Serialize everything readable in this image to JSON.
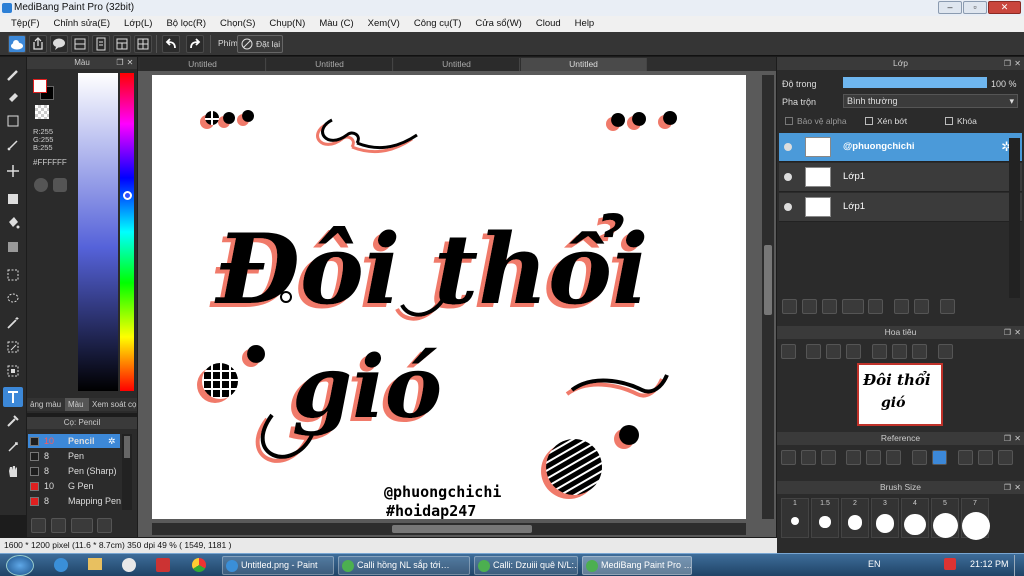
{
  "window": {
    "title": "MediBang Paint Pro (32bit)"
  },
  "menu": [
    "Tệp(F)",
    "Chỉnh sửa(E)",
    "Lớp(L)",
    "Bộ lọc(R)",
    "Chọn(S)",
    "Chụp(N)",
    "Màu (C)",
    "Xem(V)",
    "Công cụ(T)",
    "Cửa sổ(W)",
    "Cloud",
    "Help"
  ],
  "toolbar": {
    "phim_label": "Phím",
    "reset_label": "Đặt lại"
  },
  "color_panel": {
    "title": "Màu",
    "r": "R:255",
    "g": "G:255",
    "b": "B:255",
    "hex": "#FFFFFF",
    "tabs": [
      "ảng màu",
      "Màu",
      "Xem soát cọ"
    ]
  },
  "brush_panel": {
    "title": "Cọ: Pencil",
    "items": [
      {
        "size": "10",
        "name": "Pencil",
        "color": "#1e1e1e"
      },
      {
        "size": "8",
        "name": "Pen",
        "color": "#1e1e1e"
      },
      {
        "size": "8",
        "name": "Pen (Sharp)",
        "color": "#1e1e1e"
      },
      {
        "size": "10",
        "name": "G Pen",
        "color": "#e02020"
      },
      {
        "size": "8",
        "name": "Mapping Pen",
        "color": "#e02020"
      }
    ]
  },
  "tabs": [
    "Untitled",
    "Untitled",
    "Untitled",
    "Untitled"
  ],
  "artwork": {
    "line1": "Đôi thổi",
    "line2": "gió",
    "handle": "@phuongchichi",
    "hashtag": "#hoidap247"
  },
  "status": {
    "text": "1600 * 1200 pixel  (11.6 * 8.7cm)  350 dpi  49 %  ( 1549, 1181 )"
  },
  "layer_panel": {
    "title": "Lớp",
    "opacity_label": "Độ trong",
    "opacity_value": "100 %",
    "opacity_fraction": 1.0,
    "blend_label": "Pha trộn",
    "blend_value": "Bình thường",
    "protect_alpha": "Bảo vệ alpha",
    "clipping": "Xén bớt",
    "lock": "Khóa",
    "layers": [
      {
        "name": "@phuongchichi",
        "selected": true
      },
      {
        "name": "Lớp1",
        "selected": false
      },
      {
        "name": "Lớp1",
        "selected": false
      }
    ]
  },
  "navigator": {
    "title": "Hoa tiêu",
    "thumb_line1": "Đôi thổi",
    "thumb_line2": "gió"
  },
  "reference": {
    "title": "Reference"
  },
  "brush_size": {
    "title": "Brush Size",
    "labels": [
      "1",
      "1.5",
      "2",
      "3",
      "4",
      "5",
      "7"
    ]
  },
  "taskbar": {
    "items": [
      "Untitled.png - Paint",
      "Calli hồng NL sắp tới…",
      "Calli: Dzuiii quê N/L:…",
      "MediBang Paint Pro …"
    ],
    "lang": "EN",
    "clock": "21:12 PM"
  },
  "colors": {
    "accent": "#3c88d8",
    "selected_layer": "#4b9ad9",
    "ink": "#000000",
    "shadow": "#f08070"
  }
}
